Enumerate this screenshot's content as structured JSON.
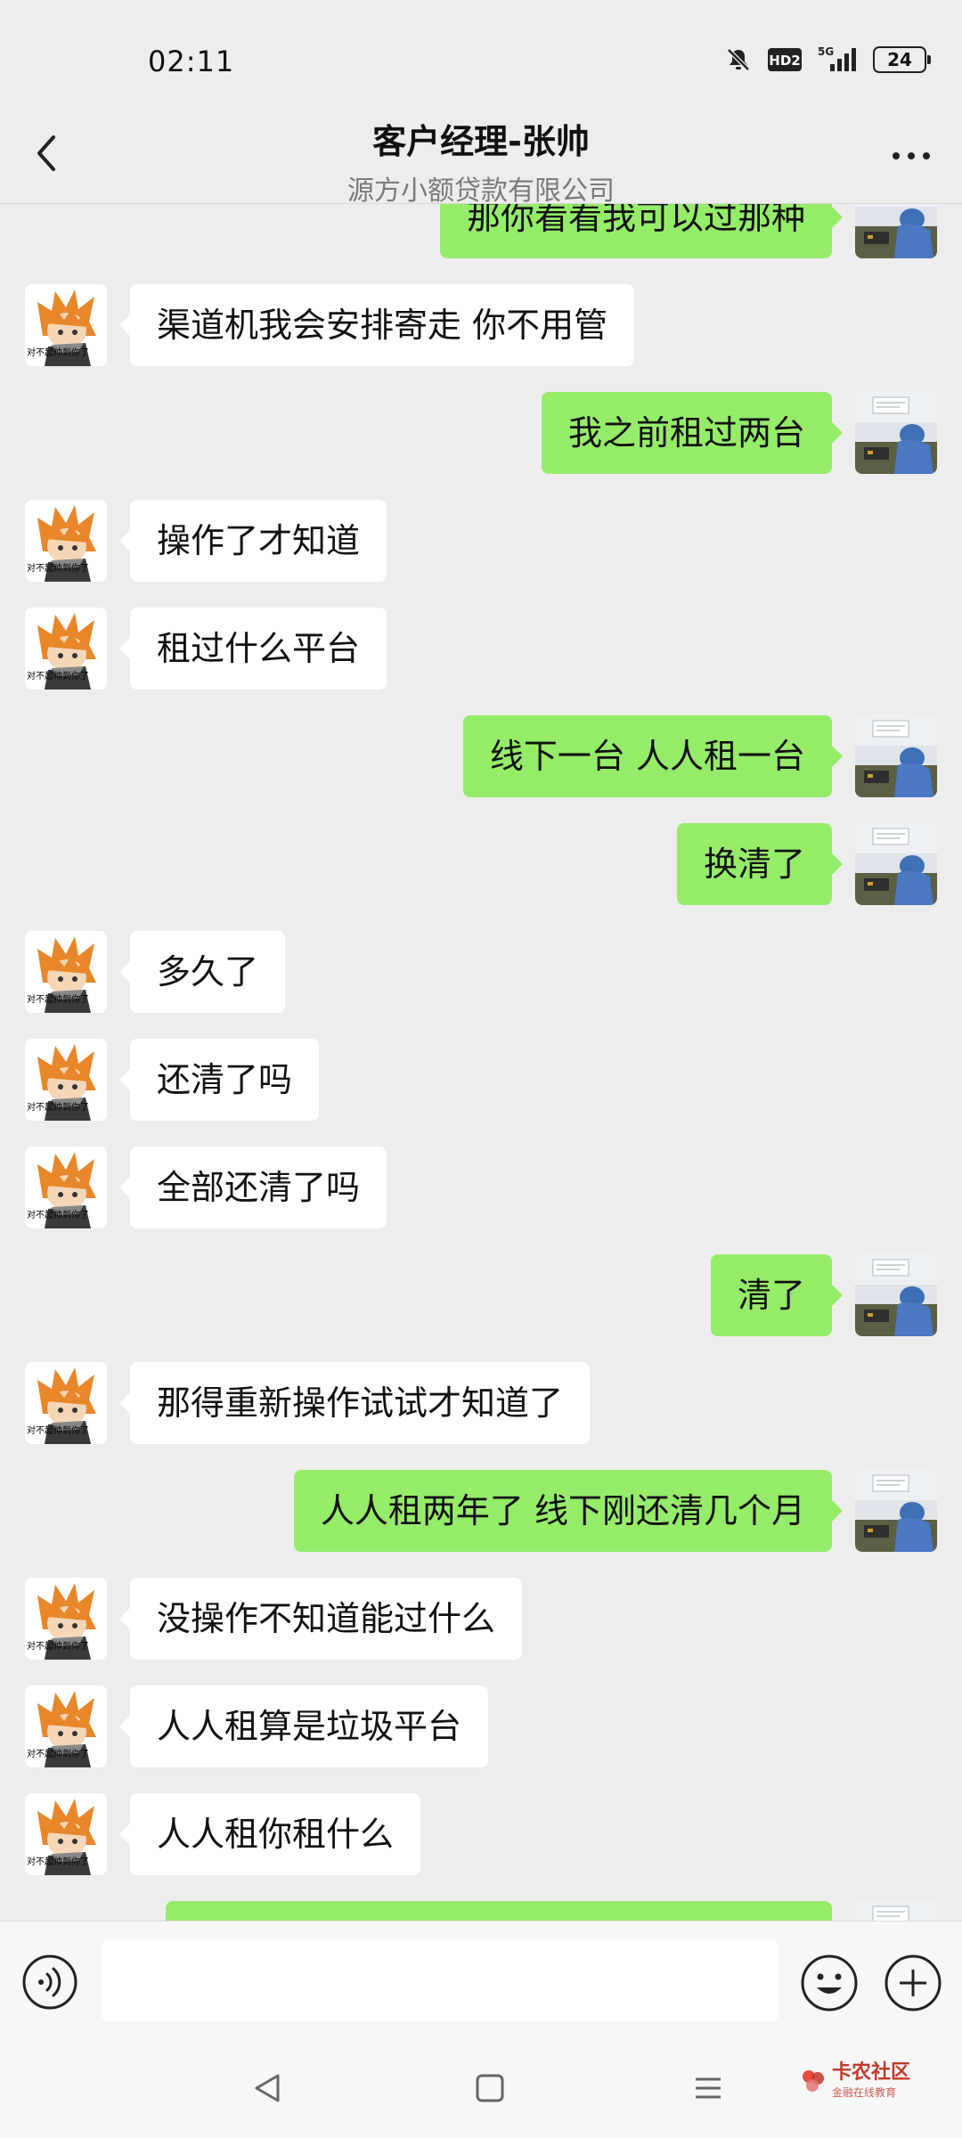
{
  "status_bar": {
    "time": "02:11",
    "network": "5G",
    "hd_label": "HD2",
    "battery": "24"
  },
  "header": {
    "title": "客户经理-张帅",
    "subtitle": "源方小额贷款有限公司"
  },
  "messages": [
    {
      "side": "right",
      "text": "那你看看我可以过那种"
    },
    {
      "side": "left",
      "text": "渠道机我会安排寄走   你不用管"
    },
    {
      "side": "right",
      "text": "我之前租过两台"
    },
    {
      "side": "left",
      "text": "操作了才知道"
    },
    {
      "side": "left",
      "text": "租过什么平台"
    },
    {
      "side": "right",
      "text": "线下一台 人人租一台"
    },
    {
      "side": "right",
      "text": "换清了"
    },
    {
      "side": "left",
      "text": "多久了"
    },
    {
      "side": "left",
      "text": "还清了吗"
    },
    {
      "side": "left",
      "text": "全部还清了吗"
    },
    {
      "side": "right",
      "text": "清了"
    },
    {
      "side": "left",
      "text": "那得重新操作试试才知道了"
    },
    {
      "side": "right",
      "text": "人人租两年了 线下刚还清几个月"
    },
    {
      "side": "left",
      "text": "没操作不知道能过什么"
    },
    {
      "side": "left",
      "text": "人人租算是垃圾平台"
    },
    {
      "side": "left",
      "text": "人人租你租什么"
    },
    {
      "side": "right",
      "text": ""
    }
  ],
  "avatars": {
    "agent_caption": "对不起帅到你了"
  },
  "input_bar": {
    "value": ""
  },
  "watermark": {
    "title": "卡农社区",
    "subtitle": "金融在线教育"
  },
  "colors": {
    "background": "#ededed",
    "sent_bubble": "#95ec69",
    "received_bubble": "#ffffff"
  }
}
